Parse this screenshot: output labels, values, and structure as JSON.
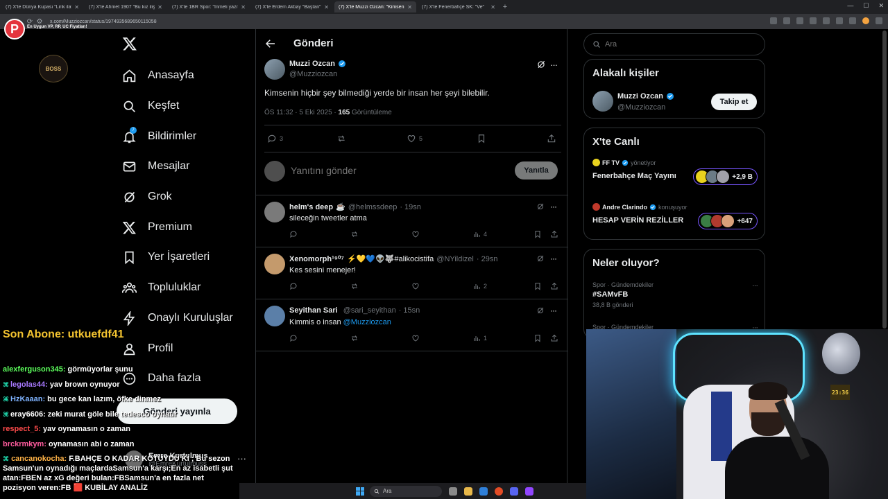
{
  "browser": {
    "tabs": [
      {
        "label": "(7) X'te Dünya Kupası \"Lirik ilave\"",
        "active": false
      },
      {
        "label": "(7) X'te Ahmet 1907 \"Bu kız ilişki\"",
        "active": false
      },
      {
        "label": "(7) X'te 1BR Spor: \"İnmeli yazı\"",
        "active": false
      },
      {
        "label": "(7) X'te Erdem Akbay \"Baştan\"",
        "active": false
      },
      {
        "label": "(7) X'te Muzzi Ozcan: \"Kimsenin\"",
        "active": true
      },
      {
        "label": "(7) X'te Fenerbahçe SK: \"Ve\"",
        "active": false
      }
    ],
    "url": "x.com/Muzziozcan/status/1974935689650115058"
  },
  "stream": {
    "logo_letter": "P",
    "tagline": "En Uygun VP, RP, UC Fiyatları!",
    "brand_logo": "BOSS",
    "sub_banner": "Son Abone: utkuefdf41"
  },
  "nav": {
    "home": "Anasayfa",
    "explore": "Keşfet",
    "notifications": "Bildirimler",
    "notif_count": "7",
    "messages": "Mesajlar",
    "grok": "Grok",
    "premium": "Premium",
    "bookmarks": "Yer İşaretleri",
    "communities": "Topluluklar",
    "verified_orgs": "Onaylı Kuruluşlar",
    "profile": "Profil",
    "more": "Daha fazla",
    "post_button": "Gönderi yayınla",
    "account_name": "Emre Kurtulmuş",
    "account_handle": "@EmreKurtulmuss"
  },
  "main": {
    "title": "Gönderi",
    "tweet": {
      "name": "Muzzi Ozcan",
      "handle": "@Muzziozcan",
      "text": "Kimsenin hiçbir şey bilmediği yerde bir insan her şeyi bilebilir.",
      "time": "ÖS 11:32 · 5 Eki 2025 · ",
      "views": "165",
      "views_label": " Görüntüleme",
      "replies": "3",
      "likes": "5"
    },
    "reply_placeholder": "Yanıtını gönder",
    "reply_button": "Yanıtla",
    "replies": [
      {
        "name": "helm's deep",
        "badge": "☕",
        "handle": "@helmssdeep",
        "time": "· 19sn",
        "text": "sileceğin tweetler atma",
        "mention": "",
        "views": "4"
      },
      {
        "name": "Xenomorph¹⁹⁰⁷",
        "badge": "⚡💛💙👽🐺#alikocistifa",
        "handle": "@NYildizel",
        "time": "· 29sn",
        "text": "Kes sesini menejer!",
        "mention": "",
        "views": "2"
      },
      {
        "name": "Seyithan Sari",
        "badge": "",
        "handle": "@sari_seyithan",
        "time": "· 15sn",
        "text": "Kimmis o insan ",
        "mention": "@Muzziozcan",
        "views": "1"
      }
    ]
  },
  "right": {
    "search_placeholder": "Ara",
    "related_title": "Alakalı kişiler",
    "related": {
      "name": "Muzzi Ozcan",
      "handle": "@Muzziozcan",
      "button": "Takip et"
    },
    "live_title": "X'te Canlı",
    "live": [
      {
        "host": "FF TV",
        "status": "yönetiyor",
        "title": "Fenerbahçe Maç Yayını",
        "count": "+2,9 B"
      },
      {
        "host": "Andre Clarindo",
        "status": "konuşuyor",
        "title": "HESAP VERİN REZİLLER",
        "count": "+647"
      }
    ],
    "trends_title": "Neler oluyor?",
    "trends": [
      {
        "category": "Spor · Gündemdekiler",
        "title": "#SAMvFB",
        "count": "38,8 B gönderi"
      },
      {
        "category": "Spor · Gündemdekiler",
        "title": "",
        "count": ""
      }
    ]
  },
  "chat": [
    {
      "user": "alexferguson345:",
      "color": "#5cff5c",
      "sub": false,
      "text": "görmüyorlar şunu"
    },
    {
      "user": "legolas44:",
      "color": "#a879ff",
      "sub": true,
      "text": "yav brown oynuyor"
    },
    {
      "user": "HzKaaan:",
      "color": "#7fb3ff",
      "sub": true,
      "text": "bu gece kan lazım, öfke dinmez"
    },
    {
      "user": "eray6606:",
      "color": "#ffffff",
      "sub": true,
      "text": "zeki murat göle bile tedesco oynatır"
    },
    {
      "user": "respect_5:",
      "color": "#ff4b4b",
      "sub": false,
      "text": "yav oynamasın o zaman"
    },
    {
      "user": "brckrmkym:",
      "color": "#ff5c9e",
      "sub": false,
      "text": "oynamasın abi o zaman"
    }
  ],
  "chat_last": {
    "user": "cancanokocha:",
    "text": "F.BAHÇE O KADAR KÖTÜYDÜ Kİ ; Bu sezon Samsun'un oynadığı maçlardaSamsun'a karşı;En az isabetli şut atan:FBEN az xG değeri bulan:FBSamsun'a en fazla net pozisyon veren:FB 🟥 KUBİLAY ANALİZ"
  },
  "webcam": {
    "clock": "23:36"
  },
  "taskbar": {
    "search": "Ara"
  },
  "colors": {
    "accent": "#1d9bf0",
    "background": "#000000",
    "border": "#2f3336",
    "muted": "#71767b",
    "live_border": "#7856ff"
  }
}
